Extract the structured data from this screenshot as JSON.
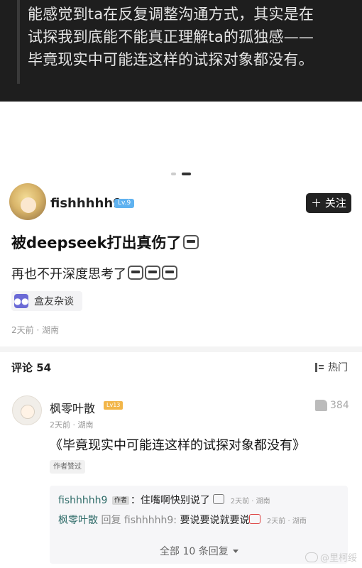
{
  "quote_block": {
    "lines": [
      "能感觉到ta在反复调整沟通方式，其实是在",
      "试探我到底能不能真正理解ta的孤独感——",
      "毕竟现实中可能连这样的试探对象都没有。"
    ]
  },
  "post": {
    "username": "fishhhhh9",
    "level": "Lv.9",
    "follow_label": "关注",
    "title": "被deepseek打出真伤了",
    "body": "再也不开深度思考了",
    "group_label": "盒友杂谈",
    "meta": "2天前 · 湖南"
  },
  "comments_header": {
    "label": "评论 54",
    "sort_label": "热门"
  },
  "comment": {
    "author": "枫零叶散",
    "level": "Lv13",
    "meta": "2天前 · 湖南",
    "likes": "384",
    "text": "《毕竟现实中可能连这样的试探对象都没有》",
    "badge": "作者赞过"
  },
  "replies": [
    {
      "name": "fishhhhh9",
      "author_tag": "作者",
      "text": "：住嘴啊快别说了",
      "time": "2天前 · 湖南"
    },
    {
      "name": "枫零叶散",
      "reply_word": "回复 fishhhhh9:",
      "text": "要说要说就要说",
      "time": "2天前 · 湖南"
    }
  ],
  "more_replies_label": "全部 10 条回复",
  "watermark": "@里柯绥",
  "icons": {
    "follow": "plus-icon",
    "group": "group-icon",
    "sort": "sort-icon",
    "like": "thumbs-up-icon",
    "more": "chevron-down-icon"
  }
}
